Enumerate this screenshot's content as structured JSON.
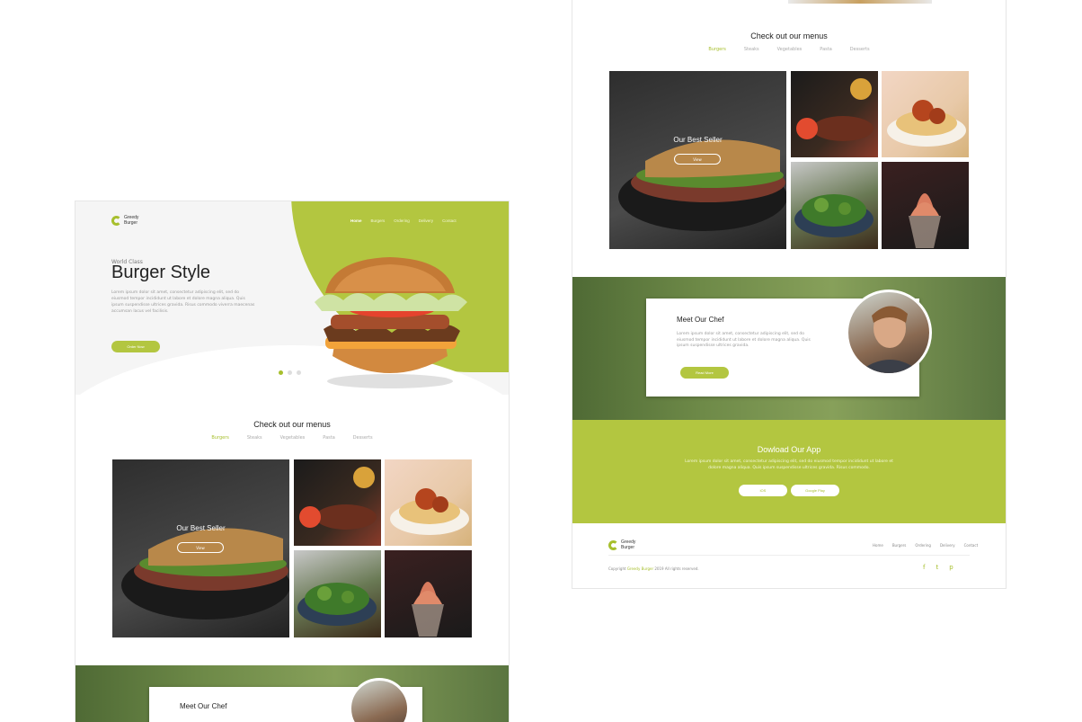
{
  "brand": {
    "line1": "Greedy",
    "line2": "Burger"
  },
  "nav": [
    "Home",
    "Burgers",
    "Ordering",
    "Delivery",
    "Contact"
  ],
  "hero": {
    "kicker": "World Class",
    "title": "Burger Style",
    "text": "Lorem ipsum dolor sit amet, consectetur adipiscing elit, sed do eiusmod tempor incididunt ut labore et dolore magna aliqua. Quis ipsum suspendisse ultrices gravida. Risus commodo viverra maecenas accumsan lacus vel facilisis.",
    "button": "Order Now"
  },
  "menus": {
    "title": "Check out our menus",
    "tabs": [
      "Burgers",
      "Steaks",
      "Vegetables",
      "Pasta",
      "Desserts"
    ],
    "best_seller": "Our Best Seller",
    "view_button": "View"
  },
  "chef": {
    "title": "Meet Our Chef",
    "text": "Lorem ipsum dolor sit amet, consectetur adipiscing elit, sed do eiusmod tempor incididunt ut labore et dolore magna aliqua. Quis ipsum suspendisse ultrices gravida.",
    "button": "Read More"
  },
  "app": {
    "title": "Dowload Our App",
    "text": "Lorem ipsum dolor sit amet, consectetur adipiscing elit, sed do eiusmod tempor incididunt ut labore et dolore magna aliqua. Quis ipsum suspendisse ultrices gravida. Risus commodo.",
    "ios": "iOS",
    "android": "Google Play"
  },
  "footer": {
    "nav": [
      "Home",
      "Burgers",
      "Ordering",
      "Delivery",
      "Contact"
    ],
    "copyright_prefix": "Copyright ",
    "copyright_brand": "Greedy Burger",
    "copyright_suffix": " 2019 All rights reserved.",
    "social": [
      "f",
      "t",
      "p"
    ]
  },
  "colors": {
    "accent": "#b3c640",
    "accent_dark": "#a7bf2d"
  }
}
